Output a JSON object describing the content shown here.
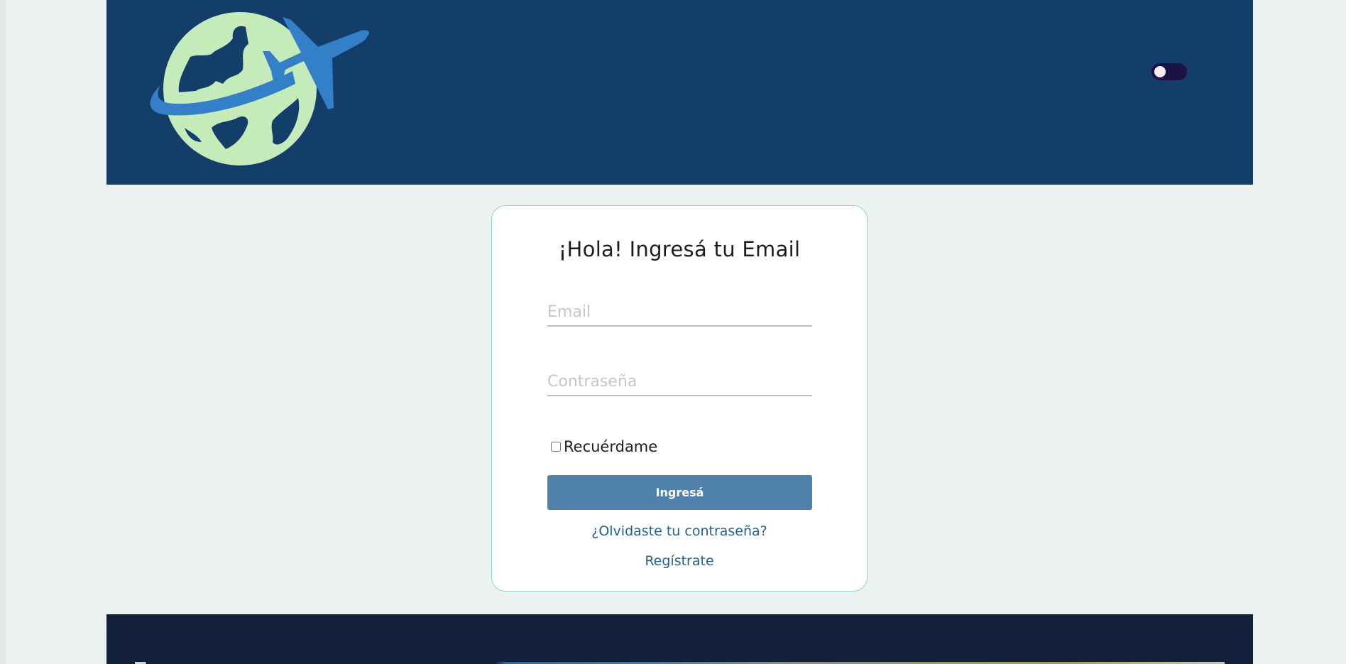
{
  "header": {
    "logo_icon": "globe-airplane-icon",
    "theme_toggle_icon": "dark-mode-toggle",
    "colors": {
      "background": "#133e6a",
      "globe": "#c5ebbb",
      "plane": "#3380c9"
    }
  },
  "login": {
    "title": "¡Hola! Ingresá tu Email",
    "email_placeholder": "Email",
    "email_value": "",
    "password_placeholder": "Contraseña",
    "password_value": "",
    "remember_label": "Recuérdame",
    "remember_checked": false,
    "submit_label": "Ingresá",
    "forgot_label": "¿Olvidaste tu contraseña?",
    "register_label": "Regístrate",
    "colors": {
      "button": "#4f81ab",
      "link": "#215f94",
      "card_border": "#8fd4c4"
    }
  },
  "footer": {
    "colors": {
      "background": "#132039"
    }
  }
}
